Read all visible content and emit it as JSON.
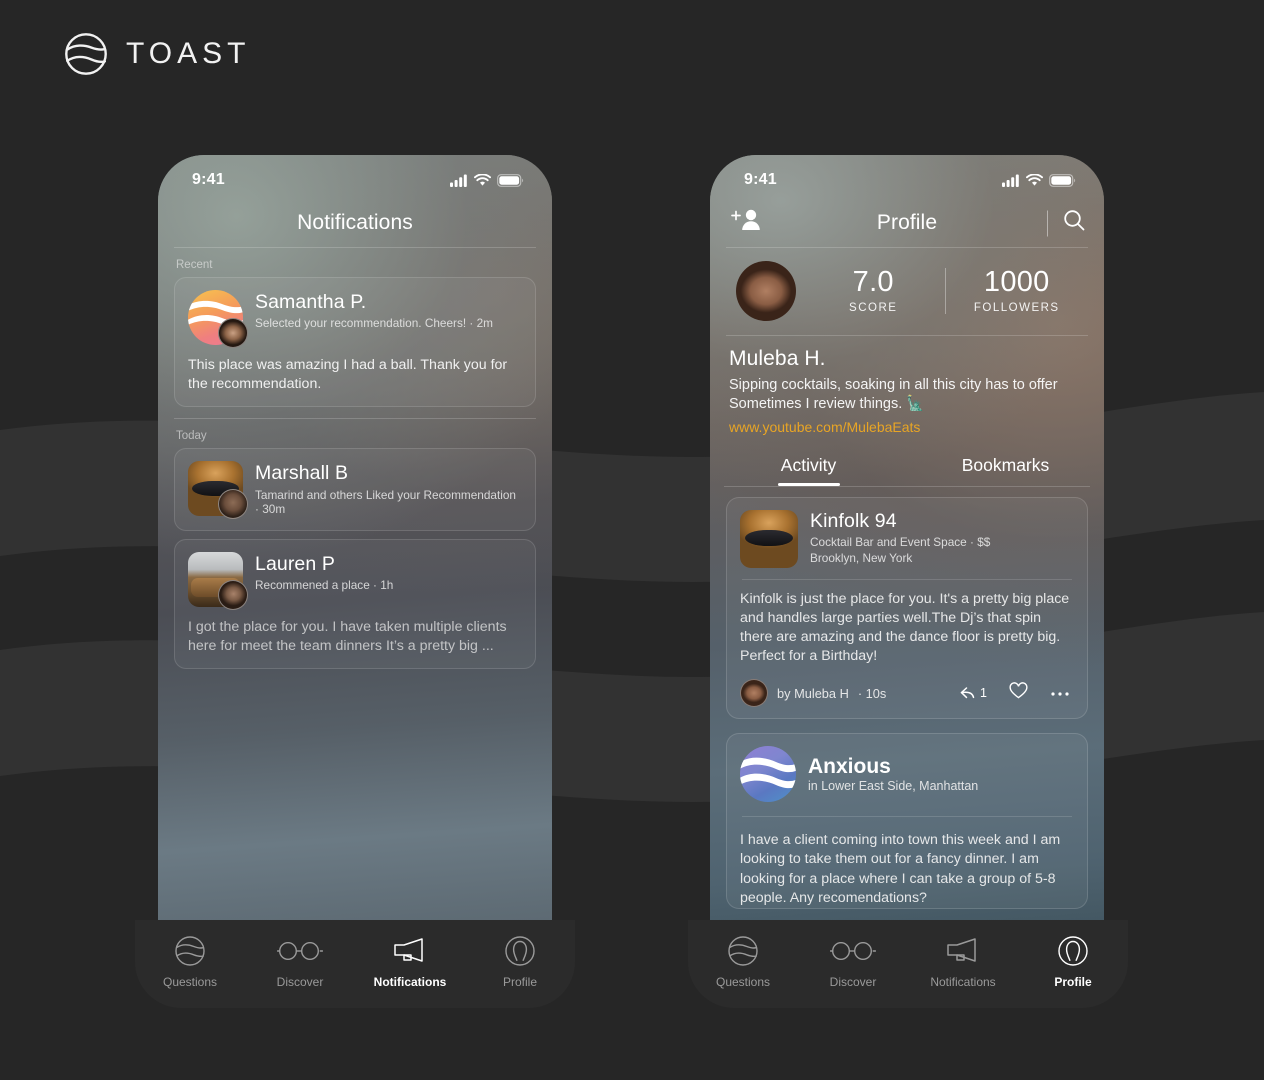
{
  "brand": {
    "name": "TOAST",
    "logo_icon": "toast-wave-logo-icon"
  },
  "phone_left": {
    "status": {
      "time": "9:41",
      "cellular_icon": "cellular-bars-icon",
      "wifi_icon": "wifi-icon",
      "battery_icon": "battery-full-icon"
    },
    "nav": {
      "title": "Notifications"
    },
    "sections": [
      {
        "label": "Recent",
        "items": [
          {
            "name": "Samantha P.",
            "subtitle": "Selected your recommendation. Cheers! · 2m",
            "body": "This place was amazing I had a ball. Thank you for the recommendation.",
            "avatar_icon": "sun-wave-logo-avatar",
            "badge_icon": "user-photo-badge"
          }
        ]
      },
      {
        "label": "Today",
        "items": [
          {
            "name": "Marshall B",
            "subtitle": "Tamarind and others Liked your Recommendation · 30m",
            "body": "",
            "avatar_icon": "venue-photo-avatar",
            "badge_icon": "user-photo-badge"
          },
          {
            "name": "Lauren P",
            "subtitle": "Recommened a place · 1h",
            "body": "I got the place for you. I have taken multiple clients here for meet the team dinners It’s a pretty big ...",
            "avatar_icon": "venue-photo-avatar",
            "badge_icon": "user-photo-badge"
          }
        ]
      }
    ],
    "tabbar": [
      {
        "label": "Questions",
        "icon": "toast-wave-icon",
        "active": false
      },
      {
        "label": "Discover",
        "icon": "glasses-icon",
        "active": false
      },
      {
        "label": "Notifications",
        "icon": "megaphone-icon",
        "active": true
      },
      {
        "label": "Profile",
        "icon": "person-outline-icon",
        "active": false
      }
    ]
  },
  "phone_right": {
    "status": {
      "time": "9:41",
      "cellular_icon": "cellular-bars-icon",
      "wifi_icon": "wifi-icon",
      "battery_icon": "battery-full-icon"
    },
    "nav": {
      "title": "Profile",
      "left_icon": "add-person-icon",
      "right_icon": "search-icon"
    },
    "stats": {
      "avatar_icon": "muleba-avatar",
      "score_value": "7.0",
      "score_label": "SCORE",
      "followers_value": "1000",
      "followers_label": "FOLLOWERS"
    },
    "profile": {
      "name": "Muleba H.",
      "bio": "Sipping cocktails, soaking in all this city has to offer Sometimes I review things. 🗽",
      "link": "www.youtube.com/MulebaEats",
      "link_color": "#e8a525"
    },
    "tabs": [
      {
        "label": "Activity",
        "active": true
      },
      {
        "label": "Bookmarks",
        "active": false
      }
    ],
    "activity": [
      {
        "kind": "venue",
        "title": "Kinfolk 94",
        "meta_line1": "Cocktail Bar and Event Space · $$",
        "meta_line2": "Brooklyn, New York",
        "thumb_icon": "kinfolk-venue-photo",
        "text": "Kinfolk is just the place for you. It's a pretty big place and handles large parties well.The Dj’s that spin there are amazing and the dance floor is pretty big. Perfect for a Birthday!",
        "author_avatar_icon": "muleba-avatar-small",
        "author": "by Muleba H",
        "time": "· 10s",
        "reply_icon": "reply-arrow-icon",
        "reply_count": "1",
        "like_icon": "heart-outline-icon",
        "more_icon": "ellipsis-icon"
      },
      {
        "kind": "question",
        "title": "Anxious",
        "meta_line1": "in Lower East Side, Manhattan",
        "logo_icon": "anxious-wave-logo-icon",
        "text": "I have a client coming into town this week and I am looking to take them out for a fancy dinner. I am looking for a place where I can take a group of 5-8 people. Any recomendations?"
      }
    ],
    "tabbar": [
      {
        "label": "Questions",
        "icon": "toast-wave-icon",
        "active": false
      },
      {
        "label": "Discover",
        "icon": "glasses-icon",
        "active": false
      },
      {
        "label": "Notifications",
        "icon": "megaphone-icon",
        "active": false
      },
      {
        "label": "Profile",
        "icon": "person-outline-icon",
        "active": true
      }
    ]
  },
  "colors": {
    "page_bg": "#262626",
    "tabbar_bg": "#2b2b2b",
    "accent_link": "#e8a525"
  }
}
